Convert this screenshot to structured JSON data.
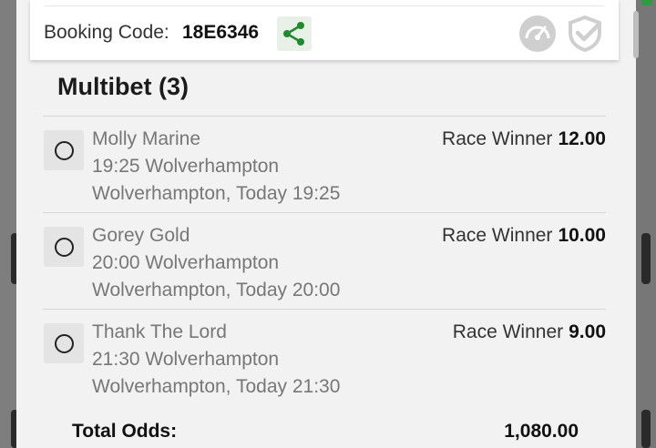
{
  "booking": {
    "label": "Booking Code:",
    "code": "18E6346"
  },
  "icons": {
    "share": "share-icon",
    "gauge": "speedometer-icon",
    "shield": "shield-check-icon"
  },
  "colors": {
    "share_accent": "#1f8a2e",
    "muted_icon": "#cfcfcf"
  },
  "section": {
    "title": "Multibet (3)"
  },
  "bets": [
    {
      "selection": "Molly Marine",
      "event": "19:25 Wolverhampton",
      "venue_time": "Wolverhampton, Today 19:25",
      "market": "Race Winner",
      "odds": "12.00"
    },
    {
      "selection": "Gorey Gold",
      "event": "20:00 Wolverhampton",
      "venue_time": "Wolverhampton, Today 20:00",
      "market": "Race Winner",
      "odds": "10.00"
    },
    {
      "selection": "Thank The Lord",
      "event": "21:30 Wolverhampton",
      "venue_time": "Wolverhampton, Today 21:30",
      "market": "Race Winner",
      "odds": "9.00"
    }
  ],
  "totals": {
    "label": "Total Odds:",
    "value": "1,080.00"
  }
}
